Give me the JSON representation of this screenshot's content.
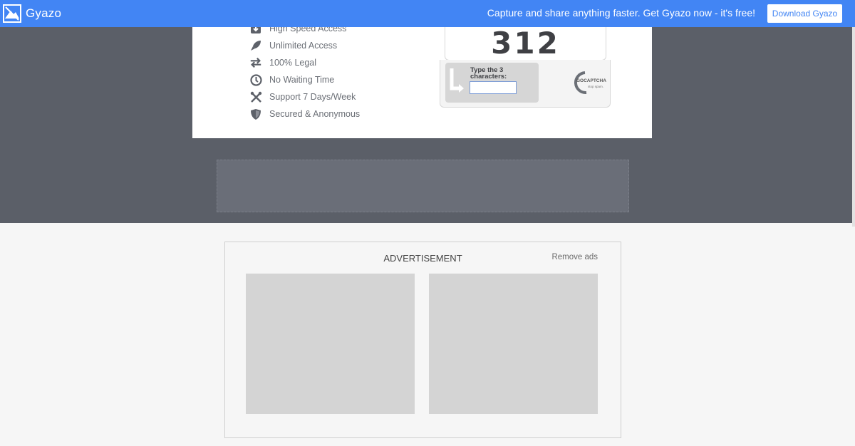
{
  "topbar": {
    "brand": "Gyazo",
    "tagline": "Capture and share anything faster. Get Gyazo now - it's free!",
    "download_label": "Download Gyazo"
  },
  "features": [
    {
      "icon": "download-icon",
      "label": "High Speed Access"
    },
    {
      "icon": "rocket-icon",
      "label": "Unlimited Access"
    },
    {
      "icon": "swap-arrows-icon",
      "label": "100% Legal"
    },
    {
      "icon": "clock-icon",
      "label": "No Waiting Time"
    },
    {
      "icon": "tools-icon",
      "label": "Support 7 Days/Week"
    },
    {
      "icon": "shield-icon",
      "label": "Secured & Anonymous"
    }
  ],
  "captcha": {
    "digits": "312",
    "prompt": "Type the 3 characters:",
    "input_value": "",
    "brand": "GOCAPTCHA",
    "brand_tagline": "stop spam."
  },
  "advertisement": {
    "title": "ADVERTISEMENT",
    "remove_label": "Remove ads"
  },
  "colors": {
    "topbar": "#4285f4",
    "dark_band": "#5b5f68",
    "feature_text": "#6b6f76"
  }
}
